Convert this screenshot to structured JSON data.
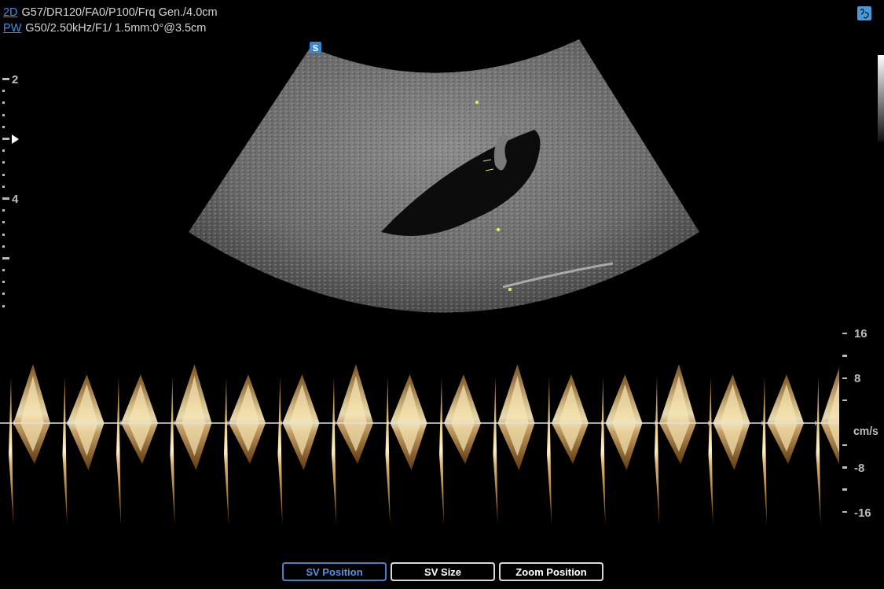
{
  "header": {
    "lines": [
      {
        "mode": "2D",
        "params": "G57/DR120/FA0/P100/Frq Gen./4.0cm"
      },
      {
        "mode": "PW",
        "params": "G50/2.50kHz/F1/ 1.5mm:0°@3.5cm"
      }
    ]
  },
  "image": {
    "badge": "S"
  },
  "depth_scale": {
    "labels": [
      "2",
      "4"
    ]
  },
  "velocity_scale": {
    "labels": [
      "16",
      "8",
      "-8",
      "-16"
    ],
    "unit": "cm/s"
  },
  "buttons": [
    {
      "label": "SV Position",
      "selected": true
    },
    {
      "label": "SV Size",
      "selected": false
    },
    {
      "label": "Zoom Position",
      "selected": false
    }
  ]
}
